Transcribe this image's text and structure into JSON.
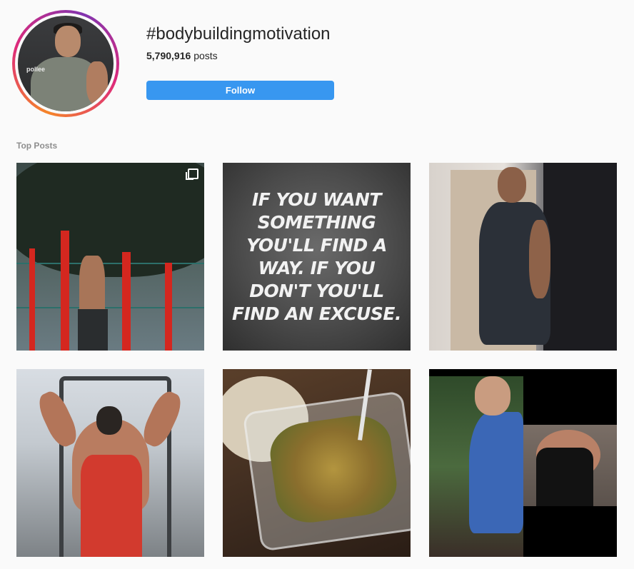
{
  "header": {
    "hashtag": "#bodybuildingmotivation",
    "posts_count": "5,790,916",
    "posts_label": "posts",
    "follow_label": "Follow"
  },
  "avatar": {
    "brand_text": "pollee"
  },
  "section": {
    "top_posts_label": "Top Posts"
  },
  "posts": [
    {
      "description": "man doing pull-ups on red bars outdoors",
      "multi": true
    },
    {
      "quote": "IF YOU WANT SOMETHING YOU'LL FIND A WAY. IF YOU DON'T YOU'LL FIND AN EXCUSE."
    },
    {
      "description": "mirror selfie in dark t-shirt"
    },
    {
      "description": "man in red tank top on gym machine"
    },
    {
      "description": "meal prep container of food"
    },
    {
      "description": "before and after physique comparison"
    }
  ],
  "colors": {
    "accent": "#3897f0",
    "background": "#fafafa",
    "muted_text": "#8e8e8e"
  }
}
